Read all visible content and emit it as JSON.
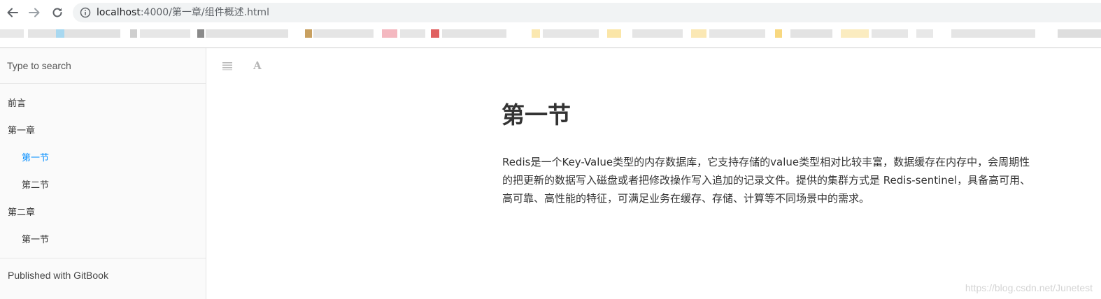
{
  "browser": {
    "url_host": "localhost",
    "url_path": ":4000/第一章/组件概述.html",
    "icons": [
      "back-arrow-icon",
      "forward-arrow-icon",
      "reload-icon",
      "info-icon"
    ]
  },
  "sidebar": {
    "search_placeholder": "Type to search",
    "toc": [
      {
        "label": "前言",
        "level": 1,
        "active": false
      },
      {
        "label": "第一章",
        "level": 1,
        "active": false
      },
      {
        "label": "第一节",
        "level": 2,
        "active": true
      },
      {
        "label": "第二节",
        "level": 2,
        "active": false
      },
      {
        "label": "第二章",
        "level": 1,
        "active": false
      },
      {
        "label": "第一节",
        "level": 2,
        "active": false
      }
    ],
    "footer": "Published with GitBook"
  },
  "toolbar": {
    "icons": [
      "menu-lines-icon",
      "font-settings-icon"
    ],
    "font_glyph": "A"
  },
  "page": {
    "title": "第一节",
    "body": "Redis是一个Key-Value类型的内存数据库，它支持存储的value类型相对比较丰富，数据缓存在内存中，会周期性的把更新的数据写入磁盘或者把修改操作写入追加的记录文件。提供的集群方式是 Redis-sentinel，具备高可用、高可靠、高性能的特征，可满足业务在缓存、存储、计算等不同场景中的需求。"
  },
  "watermark": "https://blog.csdn.net/Junetest",
  "colors": {
    "accent": "#008cff",
    "text": "#333333",
    "sidebar_bg": "#fafafa"
  }
}
